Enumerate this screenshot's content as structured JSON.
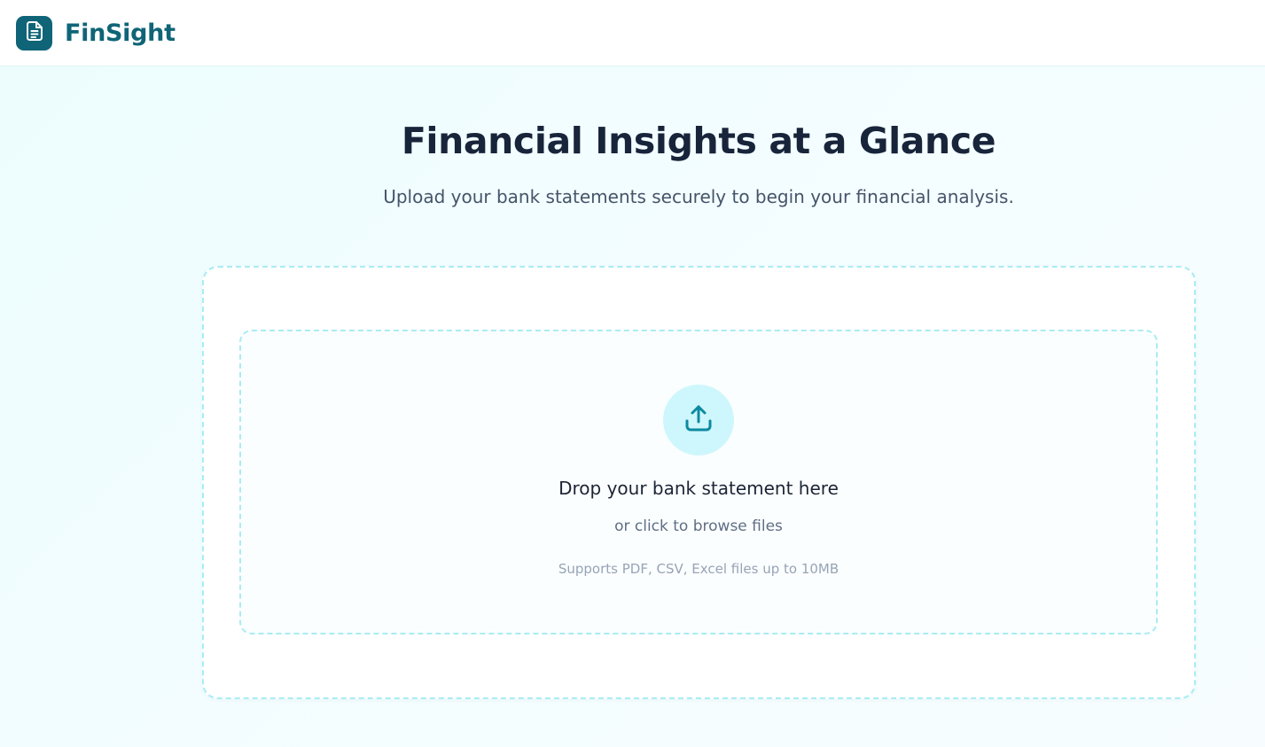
{
  "header": {
    "brand": "FinSight",
    "logo_icon": "document-icon"
  },
  "hero": {
    "title": "Financial Insights at a Glance",
    "subtitle": "Upload your bank statements securely to begin your financial analysis."
  },
  "upload": {
    "icon": "upload-icon",
    "title": "Drop your bank statement here",
    "browse_text": "or click to browse files",
    "supported_note": "Supports PDF, CSV, Excel files up to 10MB"
  },
  "colors": {
    "brand": "#0f6577",
    "accent_light": "#cdf7fc",
    "dashed_border": "#a9ecf3",
    "icon_accent": "#0e8aa0",
    "heading": "#17243a"
  }
}
